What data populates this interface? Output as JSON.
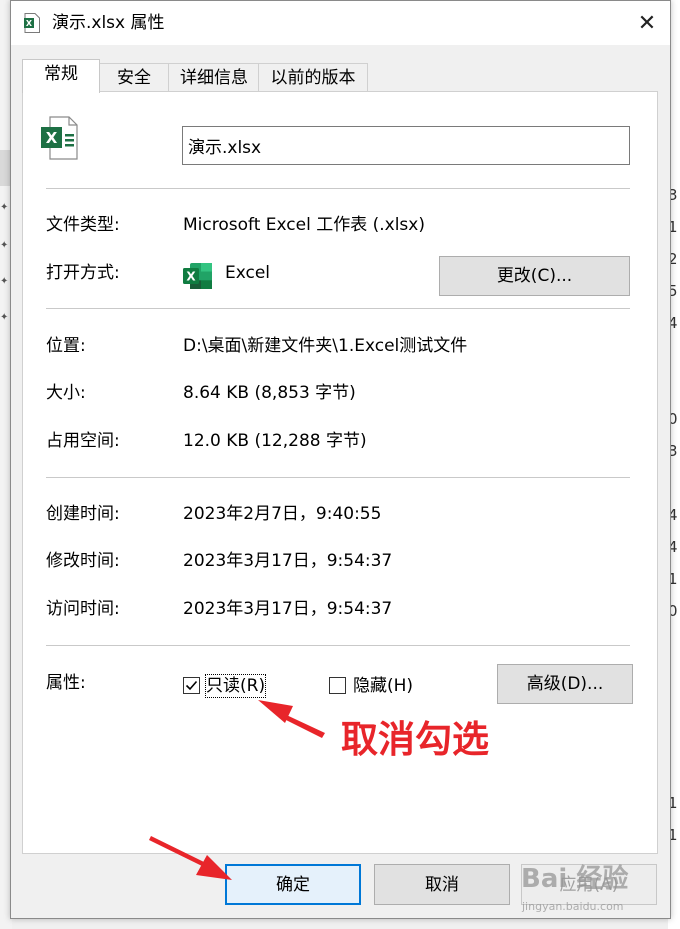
{
  "background": {
    "right_digits": [
      "3",
      "1",
      "2",
      "5",
      "4",
      "0",
      "3",
      "4",
      "4",
      "1",
      "0",
      "1",
      "1"
    ]
  },
  "window": {
    "title": "演示.xlsx 属性",
    "close_glyph": "✕"
  },
  "tabs": [
    {
      "label": "常规",
      "active": true
    },
    {
      "label": "安全",
      "active": false
    },
    {
      "label": "详细信息",
      "active": false
    },
    {
      "label": "以前的版本",
      "active": false
    }
  ],
  "general": {
    "file_name": "演示.xlsx",
    "type_label": "文件类型:",
    "type_value": "Microsoft Excel 工作表 (.xlsx)",
    "open_with_label": "打开方式:",
    "open_with_value": "Excel",
    "change_button": "更改(C)...",
    "location_label": "位置:",
    "location_value": "D:\\桌面\\新建文件夹\\1.Excel测试文件",
    "size_label": "大小:",
    "size_value": "8.64 KB (8,853 字节)",
    "size_on_disk_label": "占用空间:",
    "size_on_disk_value": "12.0 KB (12,288 字节)",
    "created_label": "创建时间:",
    "created_value": "2023年2月7日，9:40:55",
    "modified_label": "修改时间:",
    "modified_value": "2023年3月17日，9:54:37",
    "accessed_label": "访问时间:",
    "accessed_value": "2023年3月17日，9:54:37",
    "attributes_label": "属性:",
    "readonly_label": "只读(R)",
    "readonly_checked": true,
    "hidden_label": "隐藏(H)",
    "hidden_checked": false,
    "advanced_button": "高级(D)..."
  },
  "footer": {
    "ok_button": "确定",
    "cancel_button": "取消",
    "apply_button": "应用(A)"
  },
  "annotation": {
    "text": "取消勾选",
    "color": "#e8252a"
  },
  "watermark": {
    "text": "Bai 经验",
    "sub": "jingyan.baidu.com"
  },
  "icons": {
    "title": "excel-file-icon",
    "file": "excel-file-icon",
    "open_with": "excel-app-icon",
    "checkmark": "checkmark-icon",
    "close": "close-icon"
  }
}
